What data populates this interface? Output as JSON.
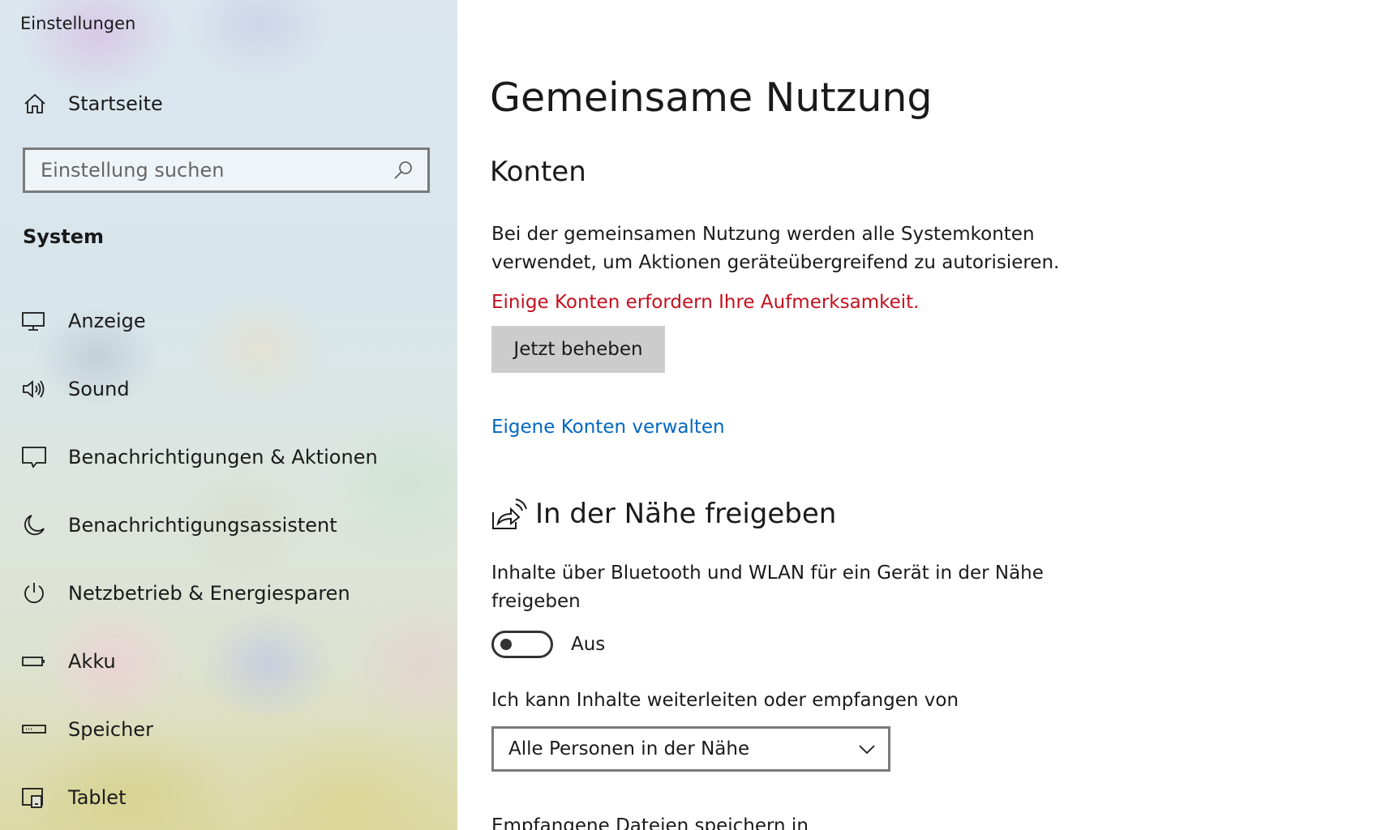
{
  "window": {
    "title": "Einstellungen"
  },
  "sidebar": {
    "home_label": "Startseite",
    "search_placeholder": "Einstellung suchen",
    "section_label": "System",
    "items": [
      {
        "label": "Anzeige",
        "icon": "monitor-icon"
      },
      {
        "label": "Sound",
        "icon": "speaker-icon"
      },
      {
        "label": "Benachrichtigungen & Aktionen",
        "icon": "notification-icon"
      },
      {
        "label": "Benachrichtigungsassistent",
        "icon": "moon-icon"
      },
      {
        "label": "Netzbetrieb & Energiesparen",
        "icon": "power-icon"
      },
      {
        "label": "Akku",
        "icon": "battery-icon"
      },
      {
        "label": "Speicher",
        "icon": "storage-icon"
      },
      {
        "label": "Tablet",
        "icon": "tablet-icon"
      }
    ]
  },
  "main": {
    "title": "Gemeinsame Nutzung",
    "accounts": {
      "heading": "Konten",
      "description": "Bei der gemeinsamen Nutzung werden alle Systemkonten verwendet, um Aktionen geräteübergreifend zu autorisieren.",
      "warning": "Einige Konten erfordern Ihre Aufmerksamkeit.",
      "fix_button": "Jetzt beheben",
      "manage_link": "Eigene Konten verwalten"
    },
    "nearby": {
      "heading": "In der Nähe freigeben",
      "description": "Inhalte über Bluetooth und WLAN für ein Gerät in der Nähe freigeben",
      "toggle_state": "Aus",
      "share_with_label": "Ich kann Inhalte weiterleiten oder empfangen von",
      "share_with_value": "Alle Personen in der Nähe",
      "save_files_label": "Empfangene Dateien speichern in"
    }
  },
  "colors": {
    "warning": "#c50f1f",
    "link": "#0067c0",
    "button_bg": "#cccccc"
  }
}
